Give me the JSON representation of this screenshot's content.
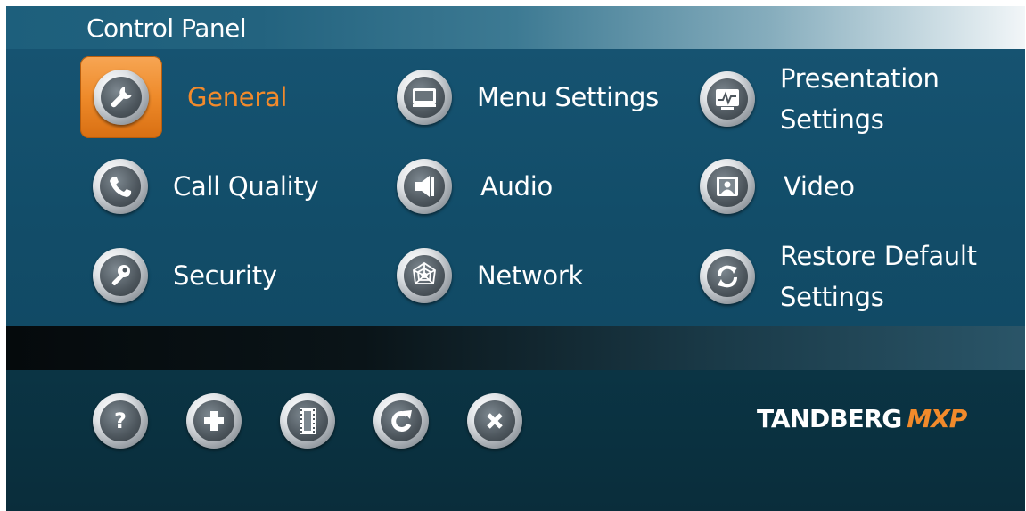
{
  "window": {
    "title": "Control Panel"
  },
  "menu": {
    "items": [
      {
        "label": "General",
        "icon": "wrench-icon",
        "selected": true
      },
      {
        "label": "Menu Settings",
        "icon": "monitor-icon",
        "selected": false
      },
      {
        "label_line1": "Presentation",
        "label_line2": "Settings",
        "icon": "presentation-icon",
        "selected": false
      },
      {
        "label": "Call Quality",
        "icon": "phone-handset-icon",
        "selected": false
      },
      {
        "label": "Audio",
        "icon": "speaker-icon",
        "selected": false
      },
      {
        "label": "Video",
        "icon": "video-icon",
        "selected": false
      },
      {
        "label": "Security",
        "icon": "key-icon",
        "selected": false
      },
      {
        "label": "Network",
        "icon": "network-web-icon",
        "selected": false
      },
      {
        "label_line1": "Restore Default",
        "label_line2": "Settings",
        "icon": "restore-icon",
        "selected": false
      }
    ]
  },
  "toolbar": {
    "buttons": [
      {
        "icon": "help-icon",
        "glyph": "?"
      },
      {
        "icon": "plus-icon",
        "glyph": "+"
      },
      {
        "icon": "film-icon",
        "glyph": ""
      },
      {
        "icon": "refresh-icon",
        "glyph": ""
      },
      {
        "icon": "close-icon",
        "glyph": "✕"
      }
    ]
  },
  "brand": {
    "name": "TANDBERG",
    "sub": "MXP"
  },
  "colors": {
    "panel_bg": "#124d69",
    "selected_accent": "#f28a2b",
    "text": "#ffffff",
    "bottom_bg": "#0a3140"
  }
}
